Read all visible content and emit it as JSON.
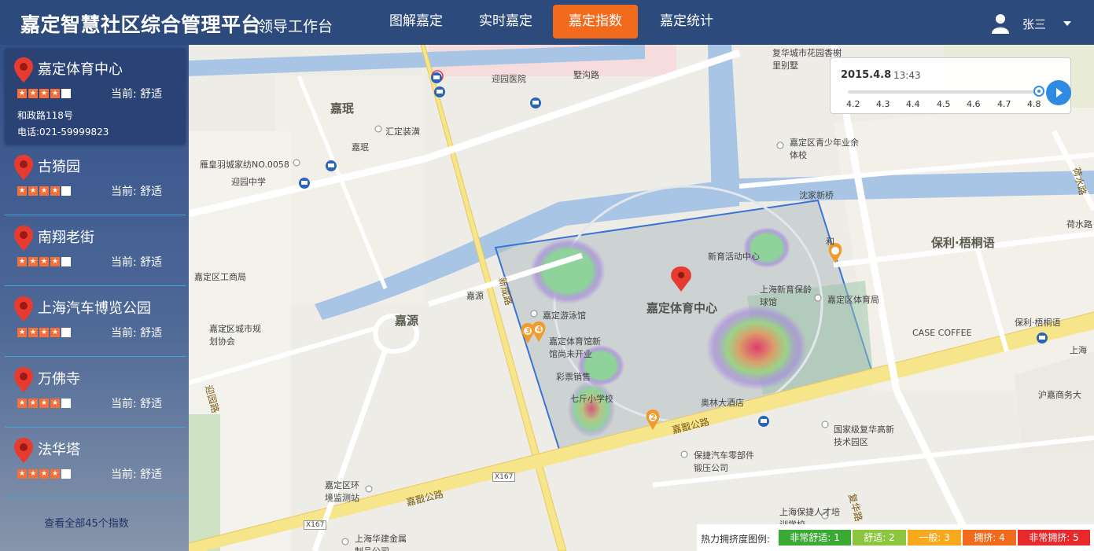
{
  "header": {
    "title": "嘉定智慧社区综合管理平台",
    "subtitle": "领导工作台",
    "tabs": [
      {
        "label": "图解嘉定",
        "active": false
      },
      {
        "label": "实时嘉定",
        "active": false
      },
      {
        "label": "嘉定指数",
        "active": true
      },
      {
        "label": "嘉定统计",
        "active": false
      }
    ],
    "user_name": "张三",
    "accent_color": "#f26b1d",
    "bar_color": "#2d4a7c"
  },
  "sidebar": {
    "items": [
      {
        "name": "嘉定体育中心",
        "rating": 4,
        "status": "当前: 舒适",
        "address": "和政路118号",
        "phone": "电话:021-59999823",
        "selected": true
      },
      {
        "name": "古猗园",
        "rating": 4,
        "status": "当前: 舒适"
      },
      {
        "name": "南翔老街",
        "rating": 4,
        "status": "当前: 舒适"
      },
      {
        "name": "上海汽车博览公园",
        "rating": 4,
        "status": "当前: 舒适"
      },
      {
        "name": "万佛寺",
        "rating": 4,
        "status": "当前: 舒适"
      },
      {
        "name": "法华塔",
        "rating": 4,
        "status": "当前: 舒适"
      }
    ],
    "view_all": "查看全部45个指数"
  },
  "map": {
    "center_label": "嘉定体育中心",
    "area_labels": [
      "嘉珉",
      "嘉源",
      "保利·梧桐语"
    ],
    "poi_labels": [
      "迎园医院",
      "墅沟路",
      "汇定装潢",
      "嘉珉",
      "雁皇羽城家纺NO.0058",
      "迎园中学",
      "嘉源",
      "嘉定区工商局",
      "嘉定区城市规划协会",
      "迎园路",
      "新成路",
      "嘉定游泳馆",
      "彩票销售",
      "七斤小学校",
      "新育活动中心",
      "上海新育保龄球馆",
      "嘉定区体育局",
      "奥林大酒店",
      "嘉戬公路",
      "保捷汽车零部件锻压公司",
      "国家级复华高新技术园区",
      "复华路",
      "CASE COFFEE",
      "保利·梧桐语",
      "沪嘉商务大",
      "复华城市花园香榭里别墅",
      "嘉定区青少年业余体校",
      "沈家新桥",
      "荷水路",
      "荷水路",
      "嘉定区环境监测站",
      "上海华建金属制品公司",
      "上海保捷人才培训学校",
      "X167",
      "X167",
      "嘉戬公路",
      "嘉定体育馆新馆尚未开业",
      "上海",
      "和"
    ],
    "markers": [
      "1",
      "2",
      "3",
      "4"
    ]
  },
  "time_control": {
    "date": "2015.4.8",
    "time": "13:43",
    "ticks": [
      "4.2",
      "4.3",
      "4.4",
      "4.5",
      "4.6",
      "4.7",
      "4.8"
    ],
    "current_fraction": 1.0
  },
  "legend": {
    "title": "热力拥挤度图例:",
    "items": [
      {
        "label": "非常舒适: 1",
        "color": "#3aaa35"
      },
      {
        "label": "舒适: 2",
        "color": "#8cc63f"
      },
      {
        "label": "一般: 3",
        "color": "#f7a81b"
      },
      {
        "label": "拥挤: 4",
        "color": "#f26b1d"
      },
      {
        "label": "非常拥挤: 5",
        "color": "#e8282b"
      }
    ]
  }
}
